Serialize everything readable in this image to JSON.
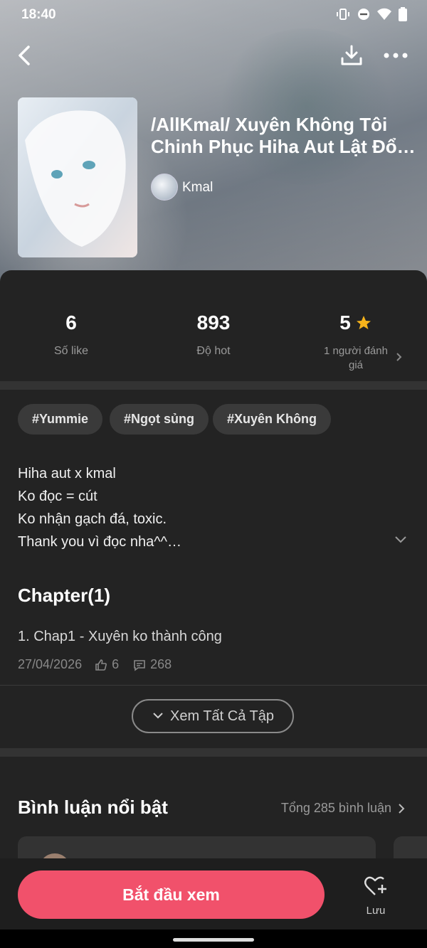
{
  "status": {
    "time": "18:40"
  },
  "story": {
    "title": "/AllKmal/ Xuyên Không Tôi Chinh Phục Hiha Aut Lật Đổ…",
    "author": "Kmal"
  },
  "stats": [
    {
      "value": "6",
      "label": "Số like"
    },
    {
      "value": "893",
      "label": "Độ hot"
    },
    {
      "value": "5",
      "label": "1 người đánh giá"
    }
  ],
  "tags": [
    "#Yummie",
    "#Ngọt sủng",
    "#Xuyên Không"
  ],
  "description": [
    "Hiha aut x kmal",
    "Ko đọc = cút",
    "Ko nhận gạch đá, toxic.",
    "Thank you vì đọc nha^^…"
  ],
  "chapters": {
    "heading": "Chapter(1)",
    "items": [
      {
        "title": "1. Chap1 - Xuyên ko thành công",
        "date": "27/04/2026",
        "likes": "6",
        "comments": "268"
      }
    ],
    "view_all": "Xem Tất Cả Tập"
  },
  "comments": {
    "heading": "Bình luận nổi bật",
    "total": "Tổng 285 bình luận"
  },
  "actions": {
    "start": "Bắt đầu xem",
    "save": "Lưu"
  },
  "colors": {
    "accent": "#f1516b",
    "star": "#f6b31b",
    "background": "#232323"
  }
}
